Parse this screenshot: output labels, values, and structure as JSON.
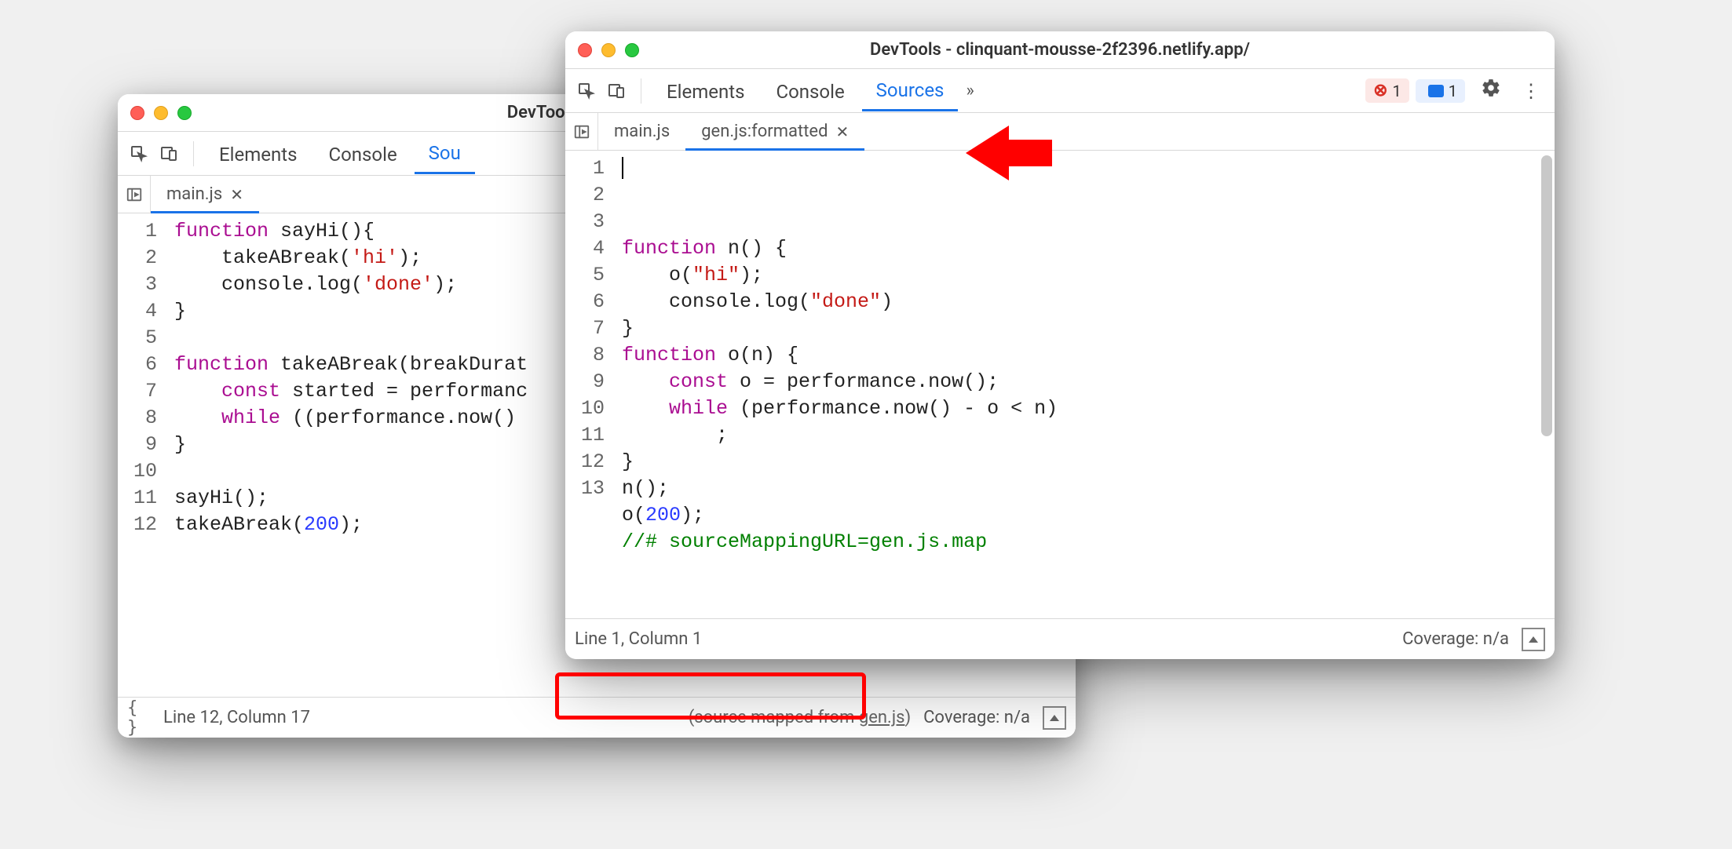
{
  "back": {
    "title": "DevTools - clinquant-m",
    "panels": [
      "Elements",
      "Console",
      "Sou"
    ],
    "activePanel": 2,
    "tabs": [
      {
        "label": "main.js",
        "active": true,
        "closable": true
      }
    ],
    "code": {
      "lines": [
        [
          {
            "t": "k",
            "v": "function"
          },
          {
            "t": "",
            "v": " sayHi(){"
          }
        ],
        [
          {
            "t": "",
            "v": "    takeABreak("
          },
          {
            "t": "s",
            "v": "'hi'"
          },
          {
            "t": "",
            "v": ");"
          }
        ],
        [
          {
            "t": "",
            "v": "    console.log("
          },
          {
            "t": "s",
            "v": "'done'"
          },
          {
            "t": "",
            "v": ");"
          }
        ],
        [
          {
            "t": "",
            "v": "}"
          }
        ],
        [
          {
            "t": "",
            "v": ""
          }
        ],
        [
          {
            "t": "k",
            "v": "function"
          },
          {
            "t": "",
            "v": " takeABreak(breakDurat"
          }
        ],
        [
          {
            "t": "",
            "v": "    "
          },
          {
            "t": "k",
            "v": "const"
          },
          {
            "t": "",
            "v": " started = performanc"
          }
        ],
        [
          {
            "t": "",
            "v": "    "
          },
          {
            "t": "k",
            "v": "while"
          },
          {
            "t": "",
            "v": " ((performance.now()"
          }
        ],
        [
          {
            "t": "",
            "v": "}"
          }
        ],
        [
          {
            "t": "",
            "v": ""
          }
        ],
        [
          {
            "t": "",
            "v": "sayHi();"
          }
        ],
        [
          {
            "t": "",
            "v": "takeABreak("
          },
          {
            "t": "n",
            "v": "200"
          },
          {
            "t": "",
            "v": ");"
          }
        ]
      ]
    },
    "status": {
      "lineCol": "Line 12, Column 17",
      "sourceMapped": "(source mapped from ",
      "sourceMappedLink": "gen.js",
      "sourceMappedEnd": ")",
      "coverage": "Coverage: n/a"
    }
  },
  "front": {
    "title": "DevTools - clinquant-mousse-2f2396.netlify.app/",
    "panels": [
      "Elements",
      "Console",
      "Sources"
    ],
    "activePanel": 2,
    "errBadge": "1",
    "msgBadge": "1",
    "tabs": [
      {
        "label": "main.js",
        "active": false,
        "closable": false
      },
      {
        "label": "gen.js:formatted",
        "active": true,
        "closable": true
      }
    ],
    "code": {
      "lines": [
        [
          {
            "t": "k",
            "v": "function"
          },
          {
            "t": "",
            "v": " n() {"
          }
        ],
        [
          {
            "t": "",
            "v": "    o("
          },
          {
            "t": "s",
            "v": "\"hi\""
          },
          {
            "t": "",
            "v": ");"
          }
        ],
        [
          {
            "t": "",
            "v": "    console.log("
          },
          {
            "t": "s",
            "v": "\"done\""
          },
          {
            "t": "",
            "v": ")"
          }
        ],
        [
          {
            "t": "",
            "v": "}"
          }
        ],
        [
          {
            "t": "k",
            "v": "function"
          },
          {
            "t": "",
            "v": " o(n) {"
          }
        ],
        [
          {
            "t": "",
            "v": "    "
          },
          {
            "t": "k",
            "v": "const"
          },
          {
            "t": "",
            "v": " o = performance.now();"
          }
        ],
        [
          {
            "t": "",
            "v": "    "
          },
          {
            "t": "k",
            "v": "while"
          },
          {
            "t": "",
            "v": " (performance.now() - o < n)"
          }
        ],
        [
          {
            "t": "",
            "v": "        ;"
          }
        ],
        [
          {
            "t": "",
            "v": "}"
          }
        ],
        [
          {
            "t": "",
            "v": "n();"
          }
        ],
        [
          {
            "t": "",
            "v": "o("
          },
          {
            "t": "n",
            "v": "200"
          },
          {
            "t": "",
            "v": ");"
          }
        ],
        [
          {
            "t": "c",
            "v": "//# sourceMappingURL=gen.js.map"
          }
        ],
        [
          {
            "t": "",
            "v": ""
          }
        ]
      ]
    },
    "status": {
      "lineCol": "Line 1, Column 1",
      "coverage": "Coverage: n/a"
    }
  }
}
